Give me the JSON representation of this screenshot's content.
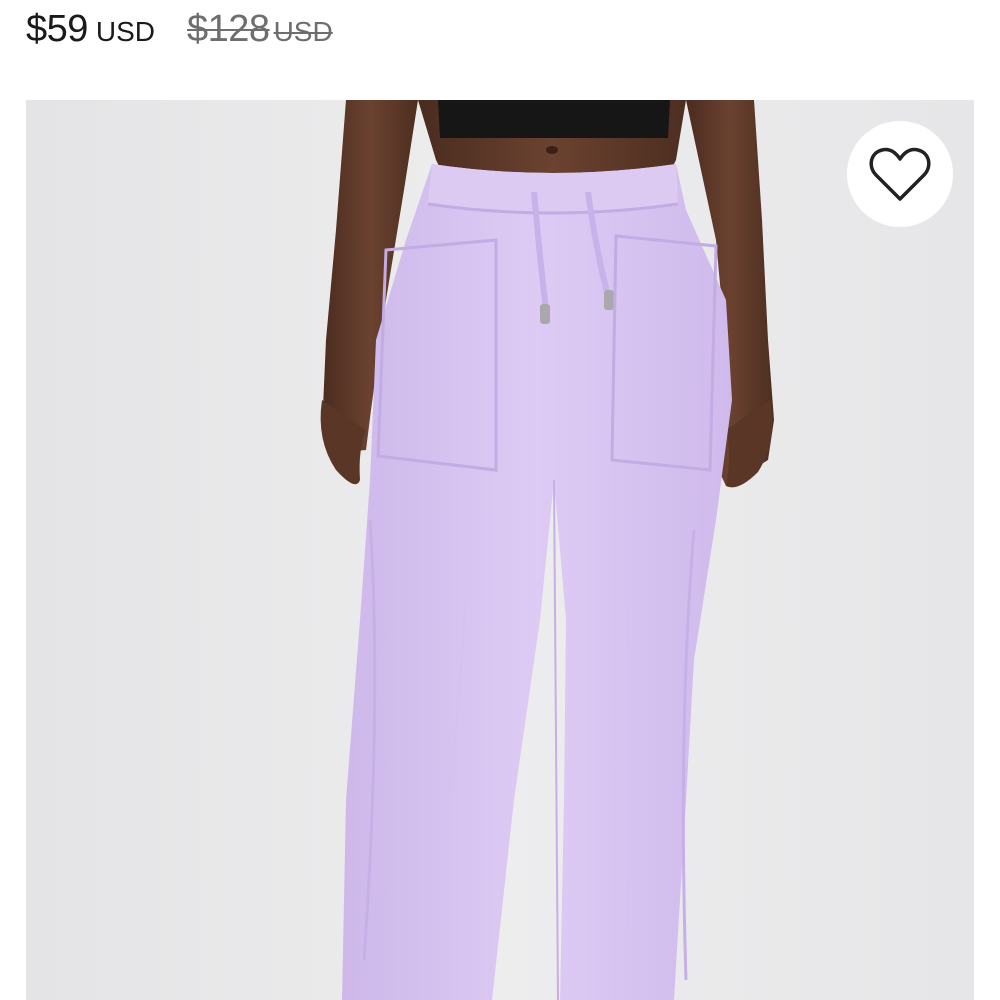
{
  "price": {
    "current_amount": "$59",
    "current_currency": "USD",
    "original_amount": "$128",
    "original_currency": "USD"
  },
  "product_image": {
    "product_color": "#d9c6f1",
    "background_color": "#e9e9ea"
  },
  "wishlist": {
    "icon": "heart-outline-icon"
  }
}
